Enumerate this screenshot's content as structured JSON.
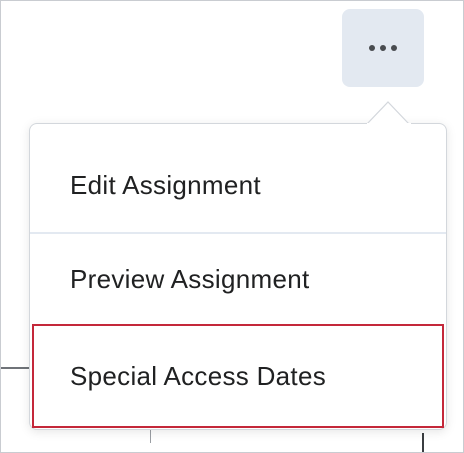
{
  "more_button": {
    "icon": "more-horizontal-icon"
  },
  "menu": {
    "items": [
      {
        "label": "Edit Assignment"
      },
      {
        "label": "Preview Assignment"
      },
      {
        "label": "Special Access Dates"
      }
    ]
  },
  "colors": {
    "button_bg": "#e3e9f1",
    "highlight_border": "#c4283a",
    "text": "#202122",
    "divider": "#e3e9f1"
  }
}
